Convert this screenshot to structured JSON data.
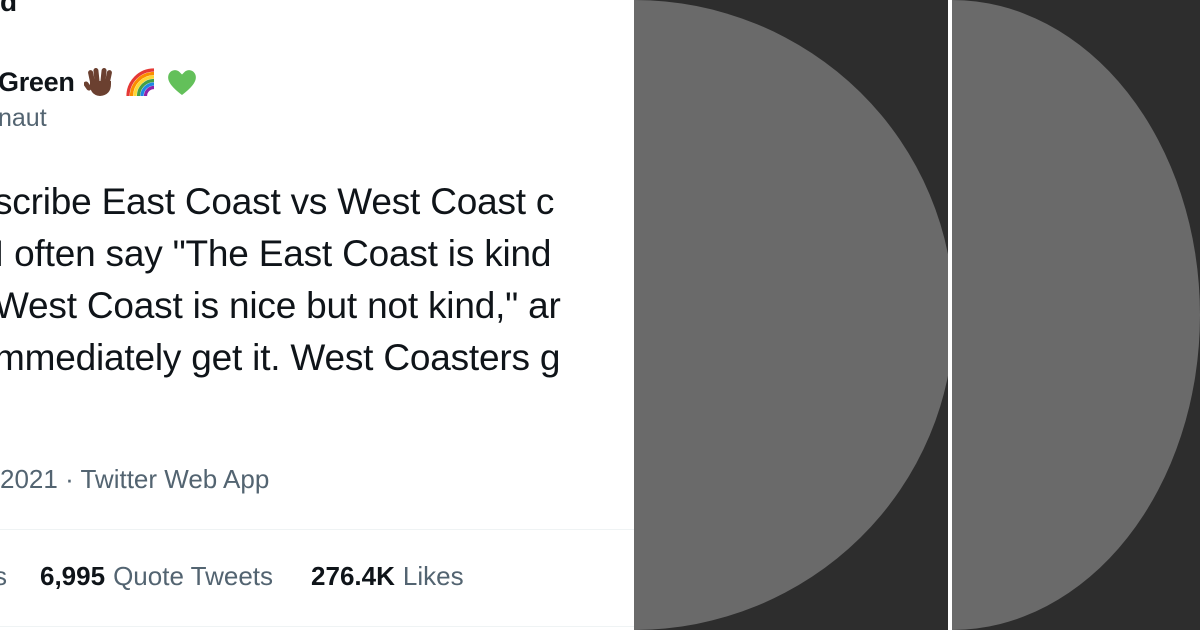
{
  "tweet": {
    "top_fragment": "d",
    "author_name": "Green",
    "author_emojis": [
      "vulcan-salute-icon",
      "rainbow-icon",
      "green-heart-icon"
    ],
    "handle": "naut",
    "text_lines": [
      "scribe East Coast vs West Coast c",
      "I often say \"The East Coast is kind",
      "West Coast is nice but not kind,\" ar",
      "mmediately get it. West Coasters g"
    ],
    "meta": "2021 · Twitter Web App",
    "stats": {
      "retweets_label_fragment": "s",
      "quote_tweets_count": "6,995",
      "quote_tweets_label": "Quote Tweets",
      "likes_count": "276.4K",
      "likes_label": "Likes"
    }
  },
  "colors": {
    "text_primary": "#0f1419",
    "text_secondary": "#536471",
    "dark_background": "#2d2d2d",
    "circle_gray": "#6a6a6a"
  }
}
